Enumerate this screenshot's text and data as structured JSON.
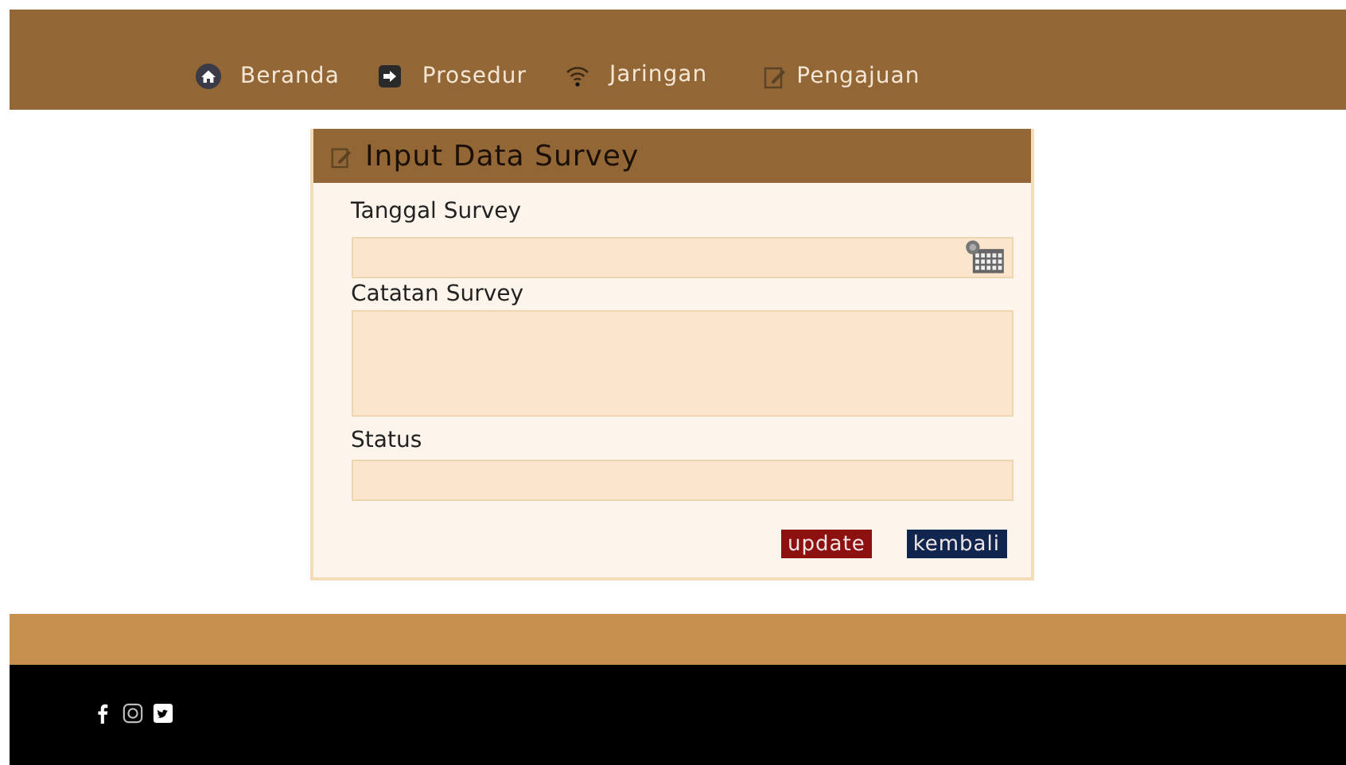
{
  "nav": [
    {
      "label": "Beranda"
    },
    {
      "label": "Prosedur"
    },
    {
      "label": "Jaringan"
    },
    {
      "label": "Pengajuan"
    }
  ],
  "form": {
    "title": "Input Data Survey",
    "fields": [
      {
        "label": "Tanggal Survey",
        "kind": "date"
      },
      {
        "label": "Catatan Survey",
        "kind": "textarea"
      },
      {
        "label": "Status",
        "kind": "text"
      }
    ],
    "buttons": [
      {
        "label": "update",
        "kind": "danger"
      },
      {
        "label": "kembali",
        "kind": "primary"
      }
    ]
  }
}
